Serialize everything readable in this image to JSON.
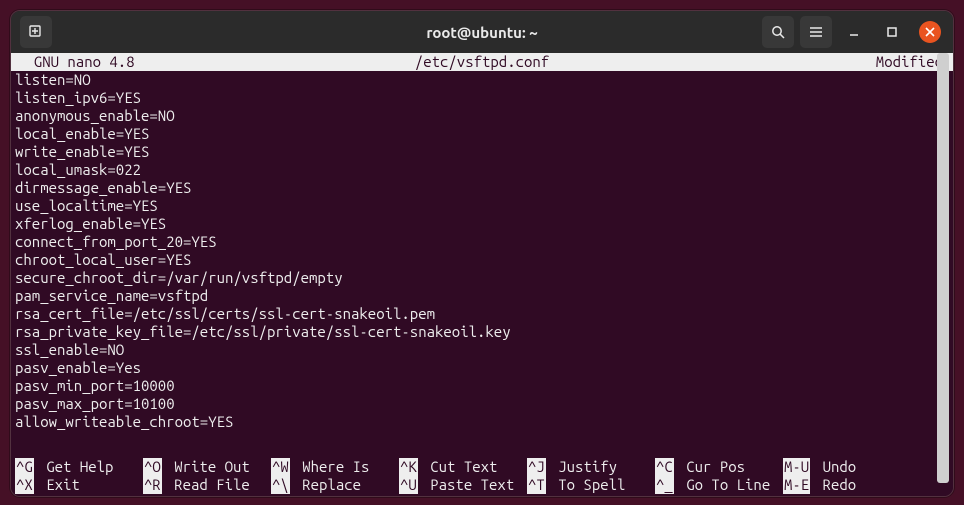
{
  "header": {
    "title": "root@ubuntu: ~"
  },
  "editor": {
    "status_left": "  GNU nano 4.8",
    "status_center": "/etc/vsftpd.conf",
    "status_right": "Modified",
    "lines": [
      "listen=NO",
      "listen_ipv6=YES",
      "anonymous_enable=NO",
      "local_enable=YES",
      "write_enable=YES",
      "local_umask=022",
      "dirmessage_enable=YES",
      "use_localtime=YES",
      "xferlog_enable=YES",
      "connect_from_port_20=YES",
      "chroot_local_user=YES",
      "secure_chroot_dir=/var/run/vsftpd/empty",
      "pam_service_name=vsftpd",
      "rsa_cert_file=/etc/ssl/certs/ssl-cert-snakeoil.pem",
      "rsa_private_key_file=/etc/ssl/private/ssl-cert-snakeoil.key",
      "ssl_enable=NO",
      "pasv_enable=Yes",
      "pasv_min_port=10000",
      "pasv_max_port=10100",
      "allow_writeable_chroot=YES"
    ],
    "shortcuts_row1": [
      {
        "key": "^G",
        "label": "Get Help"
      },
      {
        "key": "^O",
        "label": "Write Out"
      },
      {
        "key": "^W",
        "label": "Where Is"
      },
      {
        "key": "^K",
        "label": "Cut Text"
      },
      {
        "key": "^J",
        "label": "Justify"
      },
      {
        "key": "^C",
        "label": "Cur Pos"
      },
      {
        "key": "M-U",
        "label": "Undo"
      }
    ],
    "shortcuts_row2": [
      {
        "key": "^X",
        "label": "Exit"
      },
      {
        "key": "^R",
        "label": "Read File"
      },
      {
        "key": "^\\",
        "label": "Replace"
      },
      {
        "key": "^U",
        "label": "Paste Text"
      },
      {
        "key": "^T",
        "label": "To Spell"
      },
      {
        "key": "^_",
        "label": "Go To Line"
      },
      {
        "key": "M-E",
        "label": "Redo"
      }
    ]
  }
}
